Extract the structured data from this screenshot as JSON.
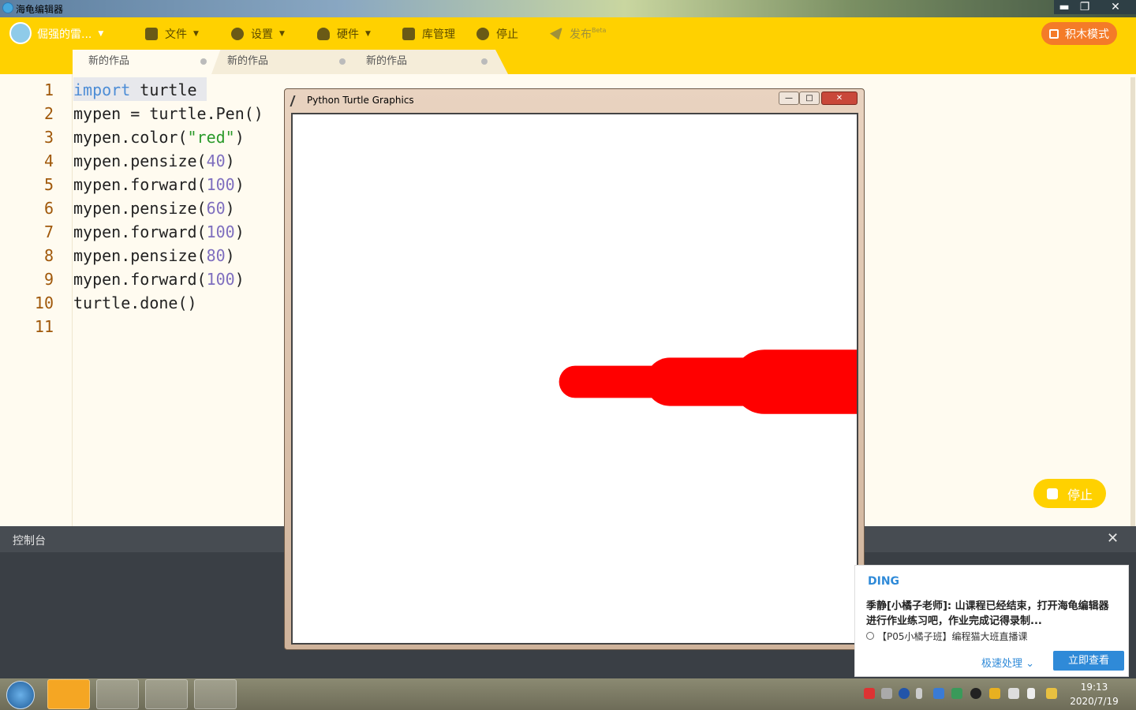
{
  "window": {
    "title": "海龟编辑器",
    "minimize": "▬",
    "restore": "❐",
    "close": "✕"
  },
  "toolbar": {
    "user": "倔强的雷...",
    "file": "文件",
    "settings": "设置",
    "hardware": "硬件",
    "library": "库管理",
    "stop": "停止",
    "publish": "发布",
    "publish_badge": "Beta",
    "block_mode": "积木模式"
  },
  "tabs": [
    {
      "label": "新的作品"
    },
    {
      "label": "新的作品"
    },
    {
      "label": "新的作品"
    }
  ],
  "editor": {
    "line_numbers": [
      "1",
      "2",
      "3",
      "4",
      "5",
      "6",
      "7",
      "8",
      "9",
      "10",
      "11"
    ],
    "lines": [
      {
        "kw": "import",
        "rest": " turtle"
      },
      {
        "text": "mypen = turtle.Pen()"
      },
      {
        "pre": "mypen.color(",
        "str": "\"red\"",
        "post": ")"
      },
      {
        "pre": "mypen.pensize(",
        "num": "40",
        "post": ")"
      },
      {
        "pre": "mypen.forward(",
        "num": "100",
        "post": ")"
      },
      {
        "pre": "mypen.pensize(",
        "num": "60",
        "post": ")"
      },
      {
        "pre": "mypen.forward(",
        "num": "100",
        "post": ")"
      },
      {
        "pre": "mypen.pensize(",
        "num": "80",
        "post": ")"
      },
      {
        "pre": "mypen.forward(",
        "num": "100",
        "post": ")"
      },
      {
        "text": "turtle.done()"
      }
    ]
  },
  "turtle_window": {
    "title": "Python Turtle Graphics",
    "min": "—",
    "max": "□",
    "close": "✕",
    "stroke_color": "#ff0000",
    "strokes": [
      {
        "pensize": 40,
        "length": 100
      },
      {
        "pensize": 60,
        "length": 100
      },
      {
        "pensize": 80,
        "length": 100
      }
    ]
  },
  "stop_button": {
    "label": "停止"
  },
  "console": {
    "title": "控制台",
    "close": "✕"
  },
  "notification": {
    "app": "DING",
    "message": "季静[小橘子老师]: 山课程已经结束，打开海龟编辑器进行作业练习吧，作业完成记得录制...",
    "source": "【P05小橘子班】编程猫大班直播课",
    "fast_action": "极速处理",
    "view_button": "立即查看"
  },
  "taskbar": {
    "time": "19:13",
    "date": "2020/7/19"
  },
  "colors": {
    "toolbar": "#ffd100",
    "accent": "#f47b28",
    "link": "#2f8ad8"
  }
}
